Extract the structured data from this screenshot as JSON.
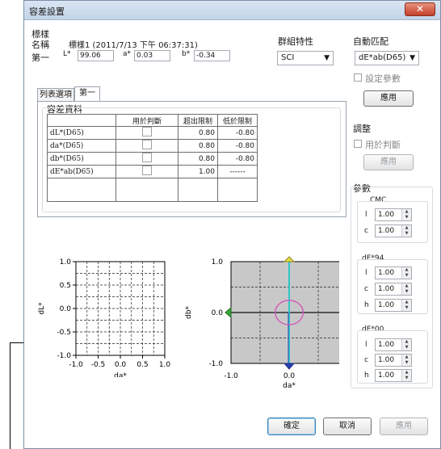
{
  "window": {
    "title": "容差設置",
    "close_glyph": "✕"
  },
  "standard": {
    "header": "標樣",
    "name_label": "名稱",
    "name_value": "標樣1 (2011/7/13 下午 06:37:31)",
    "row_label": "第一",
    "l_label": "L*",
    "l_value": "99.06",
    "a_label": "a*",
    "a_value": "0.03",
    "b_label": "b*",
    "b_value": "-0.34"
  },
  "group_attr": {
    "label": "群組特性",
    "selected": "SCI"
  },
  "auto_match": {
    "label": "自動匹配",
    "selected": "dE*ab(D65)",
    "set_params_label": "設定參數",
    "apply_label": "應用"
  },
  "tabs": [
    {
      "label": "列表選項"
    },
    {
      "label": "第一"
    }
  ],
  "tolerance": {
    "title": "容差資料",
    "headers": [
      "",
      "用於判斷",
      "超出限制",
      "低於限制"
    ],
    "rows": [
      {
        "name": "dL*(D65)",
        "upper": "0.80",
        "lower": "-0.80"
      },
      {
        "name": "da*(D65)",
        "upper": "0.80",
        "lower": "-0.80"
      },
      {
        "name": "db*(D65)",
        "upper": "0.80",
        "lower": "-0.80"
      },
      {
        "name": "dE*ab(D65)",
        "upper": "1.00",
        "lower": "------"
      }
    ]
  },
  "adjust": {
    "label": "調整",
    "use_label": "用於判斷",
    "apply_label": "應用"
  },
  "params": {
    "label": "參數",
    "cmc": {
      "title": "CMC",
      "l_label": "l",
      "l_value": "1.00",
      "c_label": "c",
      "c_value": "1.00"
    },
    "de94": {
      "title": "dE*94",
      "l_label": "l",
      "l_value": "1.00",
      "c_label": "c",
      "c_value": "1.00",
      "h_label": "h",
      "h_value": "1.00"
    },
    "de00": {
      "title": "dE*00",
      "l_label": "l",
      "l_value": "1.00",
      "c_label": "c",
      "c_value": "1.00",
      "h_label": "h",
      "h_value": "1.00"
    }
  },
  "footer": {
    "ok_label": "確定",
    "cancel_label": "取消",
    "apply_label": "應用"
  },
  "chart_data": [
    {
      "type": "scatter",
      "xlabel": "da*",
      "ylabel": "dL*",
      "xlim": [
        -1.0,
        1.0
      ],
      "ylim": [
        -1.0,
        1.0
      ],
      "xticks": [
        "-1.0",
        "-0.5",
        "0.0",
        "0.5",
        "1.0"
      ],
      "yticks": [
        "1.0",
        "0.5",
        "0.0",
        "-0.5",
        "-1.0"
      ],
      "grid": true,
      "points": []
    },
    {
      "type": "scatter",
      "xlabel": "da*",
      "ylabel": "db*",
      "xlim": [
        -1.0,
        1.0
      ],
      "ylim": [
        -1.0,
        1.0
      ],
      "xticks": [
        "-1.0",
        "0.0",
        "1.0"
      ],
      "yticks": [
        "1.0",
        "0.0",
        "-1.0"
      ],
      "tolerance_ellipse": {
        "cx": 0.0,
        "cy": 0.0,
        "rx": 0.24,
        "ry": 0.24,
        "color": "#d24fb8"
      },
      "axis_colors": {
        "pos_b": "#e8e040",
        "neg_b": "#2b3fb5",
        "pos_a": "#d42020",
        "neg_a": "#38a838"
      },
      "grid": true,
      "points": []
    }
  ]
}
